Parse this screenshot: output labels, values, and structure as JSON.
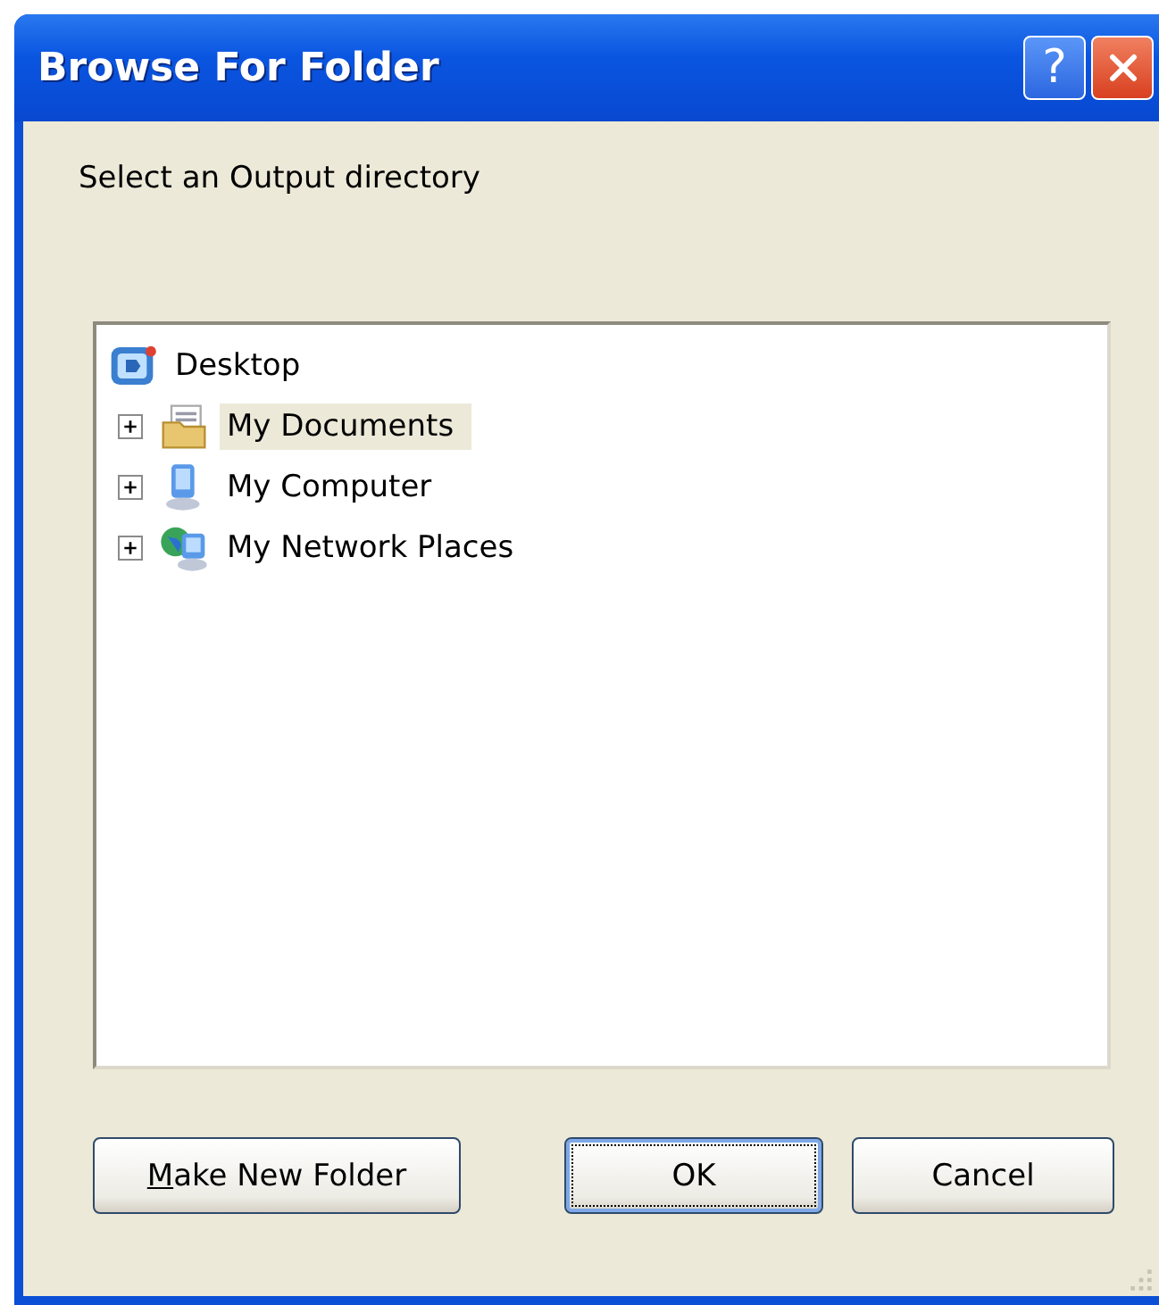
{
  "window": {
    "title": "Browse For Folder"
  },
  "title_buttons": [
    {
      "kind": "help",
      "label": "?"
    },
    {
      "kind": "close"
    }
  ],
  "prompt": "Select an Output directory",
  "tree": [
    {
      "label": "Desktop",
      "kind": "desktop",
      "selected": false,
      "children": [
        {
          "label": "My Documents",
          "kind": "documents",
          "selected": true,
          "expanded": false
        },
        {
          "label": "My Computer",
          "kind": "computer",
          "selected": false,
          "expanded": false
        },
        {
          "label": "My Network Places",
          "kind": "network",
          "selected": false,
          "expanded": false
        }
      ]
    }
  ],
  "buttons": [
    {
      "label_parts": [
        {
          "text": "M",
          "underlined": true
        },
        {
          "text": "ake New Folder",
          "underlined": false
        }
      ],
      "default": false
    },
    {
      "label": "OK",
      "default": true
    },
    {
      "label": "Cancel",
      "default": false
    }
  ]
}
